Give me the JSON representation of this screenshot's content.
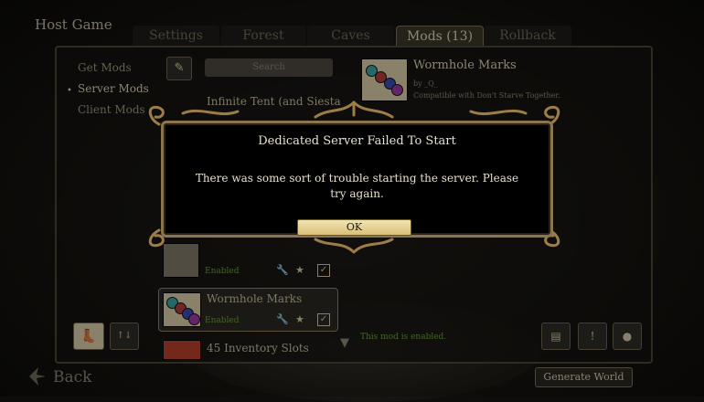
{
  "window": {
    "title": "Host Game"
  },
  "tabs": [
    {
      "label": "Settings"
    },
    {
      "label": "Forest"
    },
    {
      "label": "Caves"
    },
    {
      "label": "Mods (13)"
    },
    {
      "label": "Rollback"
    }
  ],
  "sidebar": {
    "items": [
      {
        "label": "Get Mods"
      },
      {
        "label": "Server Mods"
      },
      {
        "label": "Client Mods"
      }
    ],
    "active_marker": "•"
  },
  "search": {
    "placeholder": "Search"
  },
  "mod_list": {
    "items": [
      {
        "name": "Infinite Tent (and Siesta"
      },
      {
        "name": "",
        "status": "Enabled"
      },
      {
        "name": "Wormhole Marks",
        "status": "Enabled"
      },
      {
        "name": "45 Inventory Slots"
      }
    ]
  },
  "mod_detail": {
    "title": "Wormhole Marks",
    "author": "by _Q_",
    "compatibility": "Compatible with Don't Starve Together.",
    "status": "This mod is enabled."
  },
  "dialog": {
    "title": "Dedicated Server Failed To Start",
    "message": "There was some sort of trouble starting the server. Please try again.",
    "ok_label": "OK"
  },
  "footer": {
    "back_label": "Back",
    "generate_label": "Generate World"
  },
  "colors": {
    "enabled_text": "#6a9a3a",
    "ok_button": "#f3e3b0",
    "dialog_border": "#8a7550"
  }
}
